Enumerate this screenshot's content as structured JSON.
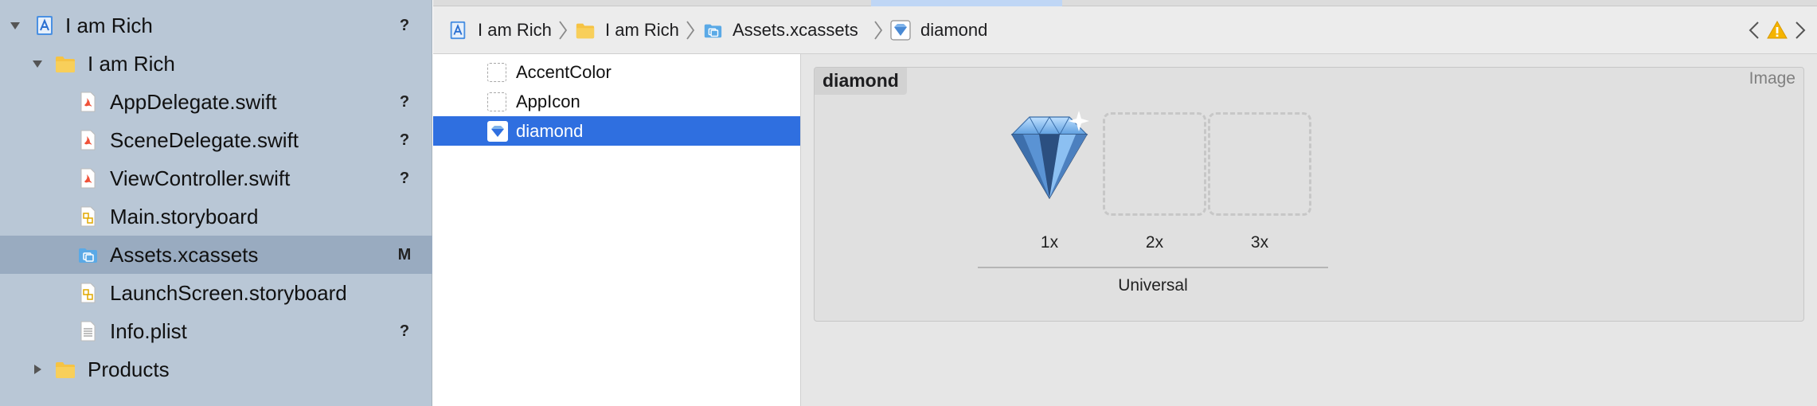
{
  "navigator": {
    "items": [
      {
        "label": "I am Rich",
        "status": "?",
        "icon": "project-icon"
      },
      {
        "label": "I am Rich",
        "status": "",
        "icon": "folder-icon"
      },
      {
        "label": "AppDelegate.swift",
        "status": "?",
        "icon": "swift-file-icon"
      },
      {
        "label": "SceneDelegate.swift",
        "status": "?",
        "icon": "swift-file-icon"
      },
      {
        "label": "ViewController.swift",
        "status": "?",
        "icon": "swift-file-icon"
      },
      {
        "label": "Main.storyboard",
        "status": "",
        "icon": "storyboard-icon"
      },
      {
        "label": "Assets.xcassets",
        "status": "M",
        "icon": "assets-catalog-icon",
        "selected": true
      },
      {
        "label": "LaunchScreen.storyboard",
        "status": "",
        "icon": "storyboard-icon"
      },
      {
        "label": "Info.plist",
        "status": "?",
        "icon": "plist-icon"
      },
      {
        "label": "Products",
        "status": "",
        "icon": "folder-icon"
      }
    ]
  },
  "jumpbar": {
    "crumbs": [
      {
        "label": "I am Rich",
        "icon": "project-icon"
      },
      {
        "label": "I am Rich",
        "icon": "folder-icon"
      },
      {
        "label": "Assets.xcassets",
        "icon": "assets-catalog-icon"
      },
      {
        "label": "diamond",
        "icon": "image-set-icon"
      }
    ]
  },
  "assets": {
    "items": [
      {
        "label": "AccentColor",
        "icon": "color-set-icon"
      },
      {
        "label": "AppIcon",
        "icon": "app-icon-set-icon"
      },
      {
        "label": "diamond",
        "icon": "image-set-icon",
        "selected": true
      }
    ]
  },
  "detail": {
    "set_name": "diamond",
    "set_type": "Image",
    "slots": [
      {
        "scale": "1x",
        "filled": true
      },
      {
        "scale": "2x",
        "filled": false
      },
      {
        "scale": "3x",
        "filled": false
      }
    ],
    "idiom": "Universal"
  },
  "colors": {
    "navigator_bg": "#b9c7d6",
    "navigator_selected": "#99abc0",
    "list_selection": "#2f6fe0",
    "warning": "#f5b400",
    "folder": "#f6c343"
  }
}
